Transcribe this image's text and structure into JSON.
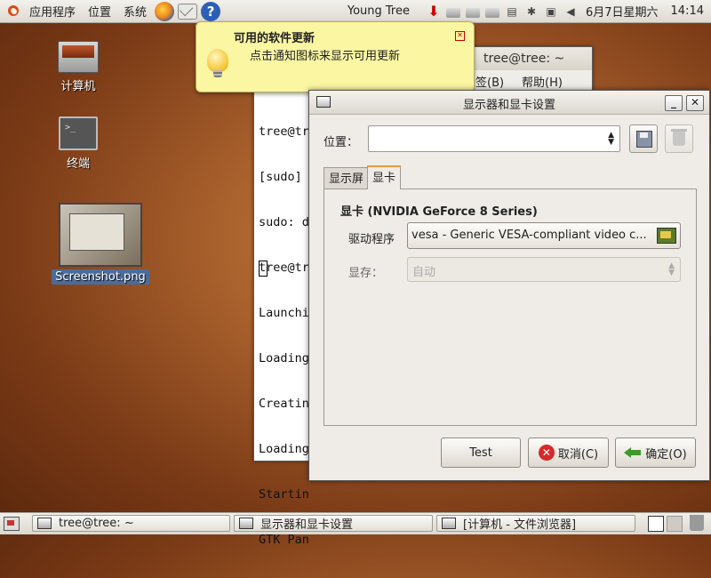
{
  "top_panel": {
    "menus": [
      "应用程序",
      "位置",
      "系统"
    ],
    "launchers": [
      "firefox-icon",
      "mail-icon",
      "help-icon"
    ],
    "help_glyph": "?",
    "user": "Young Tree",
    "date": "6月7日星期六",
    "time": "14:14"
  },
  "desktop": {
    "computer": "计算机",
    "terminal": "终端",
    "screenshot": "Screenshot.png"
  },
  "notification": {
    "title": "可用的软件更新",
    "body": "点击通知图标来显示可用更新"
  },
  "terminal": {
    "title": "tree@tree: ~",
    "menu_tab": "标签(B)",
    "menu_help": "帮助(H)",
    "lines": [
      "tree@tr",
      "[sudo]",
      "sudo: d",
      "tree@tr",
      "Launchi",
      "Loading",
      "Creatin",
      "Loading",
      "Startin",
      "GTK Pan"
    ]
  },
  "dialog": {
    "title": "显示器和显卡设置",
    "min_glyph": "_",
    "close_glyph": "✕",
    "location_label": "位置：",
    "location_value": "",
    "tabs": [
      "显示屏",
      "显卡"
    ],
    "active_tab": 1,
    "card_heading": "显卡 (NVIDIA GeForce 8 Series)",
    "driver_label": "驱动程序",
    "driver_value": "vesa - Generic VESA-compliant video c...",
    "memory_label": "显存：",
    "memory_value": "自动",
    "buttons": {
      "test": "Test",
      "cancel": "取消(C)",
      "ok": "确定(O)"
    }
  },
  "taskbar": {
    "tasks": [
      "tree@tree: ~",
      "显示器和显卡设置",
      "[计算机 - 文件浏览器]"
    ]
  },
  "colors": {
    "accent_orange": "#e89a3c",
    "notify_bg": "#fbf6a2",
    "dialog_bg": "#efebe7",
    "cancel_red": "#d62a2a",
    "ok_green": "#3b9a28"
  }
}
